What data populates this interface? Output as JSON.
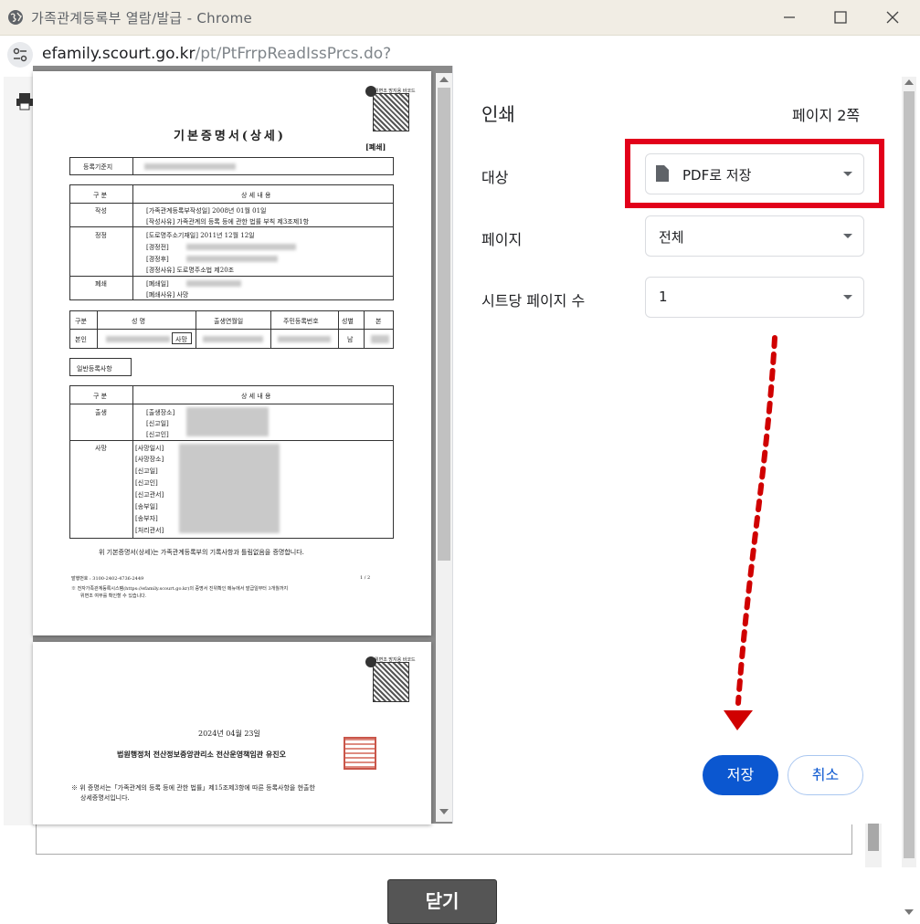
{
  "window": {
    "title": "가족관계등록부 열람/발급 - Chrome",
    "url_host": "efamily.scourt.go.kr",
    "url_path": "/pt/PtFrrpReadIssPrcs.do?"
  },
  "print_panel": {
    "title": "인쇄",
    "page_count": "페이지 2쪽",
    "destination_label": "대상",
    "destination_value": "PDF로 저장",
    "pages_label": "페이지",
    "pages_value": "전체",
    "pps_label": "시트당 페이지 수",
    "pps_value": "1",
    "save_label": "저장",
    "cancel_label": "취소"
  },
  "underlying_page": {
    "close_label": "닫기"
  },
  "document": {
    "title": "기본증명서(상세)",
    "badge": "[폐쇄]",
    "reg_base_label": "등록기준지",
    "section_header_col1": "구 분",
    "section_header_col2": "상 세 내 용",
    "r1_label": "작성",
    "r1_line1": "[가족관계등록부작성일]    2008년 01월 01일",
    "r1_line2": "[작성사유]  가족관계의 등록 등에 관한 법률 부칙 제3조제1항",
    "r2_label": "정정",
    "r2_line1": "[도로명주소기재일]    2011년 12월 12일",
    "r2_line2": "[경정전]",
    "r2_line3": "[경정후]",
    "r2_line4": "[경정사유]  도로명주소법 제20조",
    "r3_label": "폐쇄",
    "r3_line1": "[폐쇄일]",
    "r3_line2": "[폐쇄사유]  사망",
    "p_h1": "구분",
    "p_h2": "성   명",
    "p_h3": "출생연월일",
    "p_h4": "주민등록번호",
    "p_h5": "성별",
    "p_h6": "본",
    "p_row_label": "본인",
    "p_dead": "사망",
    "p_gender": "남",
    "general_label": "일반등록사항",
    "g_h1": "구 분",
    "g_h2": "상 세 내 용",
    "birth_label": "출생",
    "birth_l1": "[출생장소]",
    "birth_l2": "[신고일]",
    "birth_l3": "[신고인]",
    "death_label": "사망",
    "death_l1": "[사망일시]",
    "death_l2": "[사망장소]",
    "death_l3": "[신고일]",
    "death_l4": "[신고인]",
    "death_l5": "[신고관서]",
    "death_l6": "[송부일]",
    "death_l7": "[송부자]",
    "death_l8": "[처리관서]",
    "certify": "위 기본증명서(상세)는 가족관계등록부의 기록사항과 틀림없음을 증명합니다.",
    "issue_no": "발행번호 : 3100-2402-4736-2449",
    "page_no": "1  /  2",
    "note1": "※ 전자가족관계등록시스템(https://efamily.scourt.go.kr)의 증명서 진위확인 메뉴에서 발급일부터 3개월까지",
    "note2": "위변조 여부를 확인할 수 있습니다.",
    "qr_caption": "위변조 방지용 바코드",
    "p2_date": "2024년 04월 23일",
    "p2_issuer": "법원행정처 전산정보중앙관리소 전산운영책임관 유진오",
    "p2_note1": "※ 위 증명서는「가족관계의 등록 등에 관한 법률」제15조제3항에 따른 등록사항을 현출한",
    "p2_note2": "상세증명서입니다.",
    "seal_text": "법원행정처"
  },
  "colors": {
    "accent": "#0b57d0",
    "highlight": "#e2001a",
    "arrow": "#d00000"
  }
}
